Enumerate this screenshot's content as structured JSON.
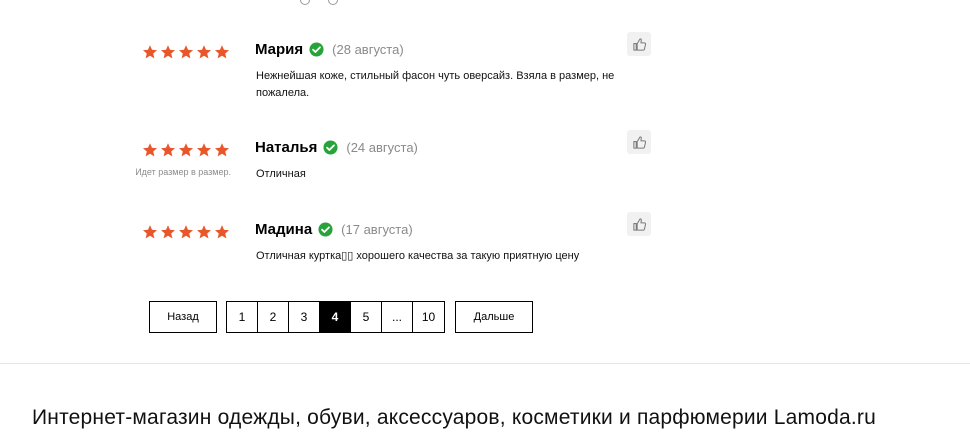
{
  "reviews": [
    {
      "author": "Мария",
      "date": "(28 августа)",
      "rating": 5,
      "fit_note": "",
      "text": "Нежнейшая коже, стильный фасон чуть оверсайз. Взяла в размер, не пожалела."
    },
    {
      "author": "Наталья",
      "date": "(24 августа)",
      "rating": 5,
      "fit_note": "Идет размер в размер.",
      "text": "Отличная"
    },
    {
      "author": "Мадина",
      "date": "(17 августа)",
      "rating": 5,
      "fit_note": "",
      "text": "Отличная куртка▯▯ хорошего качества за такую приятную цену"
    }
  ],
  "pagination": {
    "prev_label": "Назад",
    "next_label": "Дальше",
    "pages": [
      "1",
      "2",
      "3",
      "4",
      "5",
      "...",
      "10"
    ],
    "current": "4"
  },
  "footer": {
    "title": "Интернет-магазин одежды, обуви, аксессуаров, косметики и парфюмерии Lamoda.ru"
  },
  "colors": {
    "star": "#E8562A",
    "verified": "#27A33A",
    "date": "#8A8A8A",
    "like_bg": "#F1F1F1"
  },
  "icons": {
    "rating": "star-icon",
    "verified": "check-circle-icon",
    "like": "thumbs-up-icon"
  }
}
